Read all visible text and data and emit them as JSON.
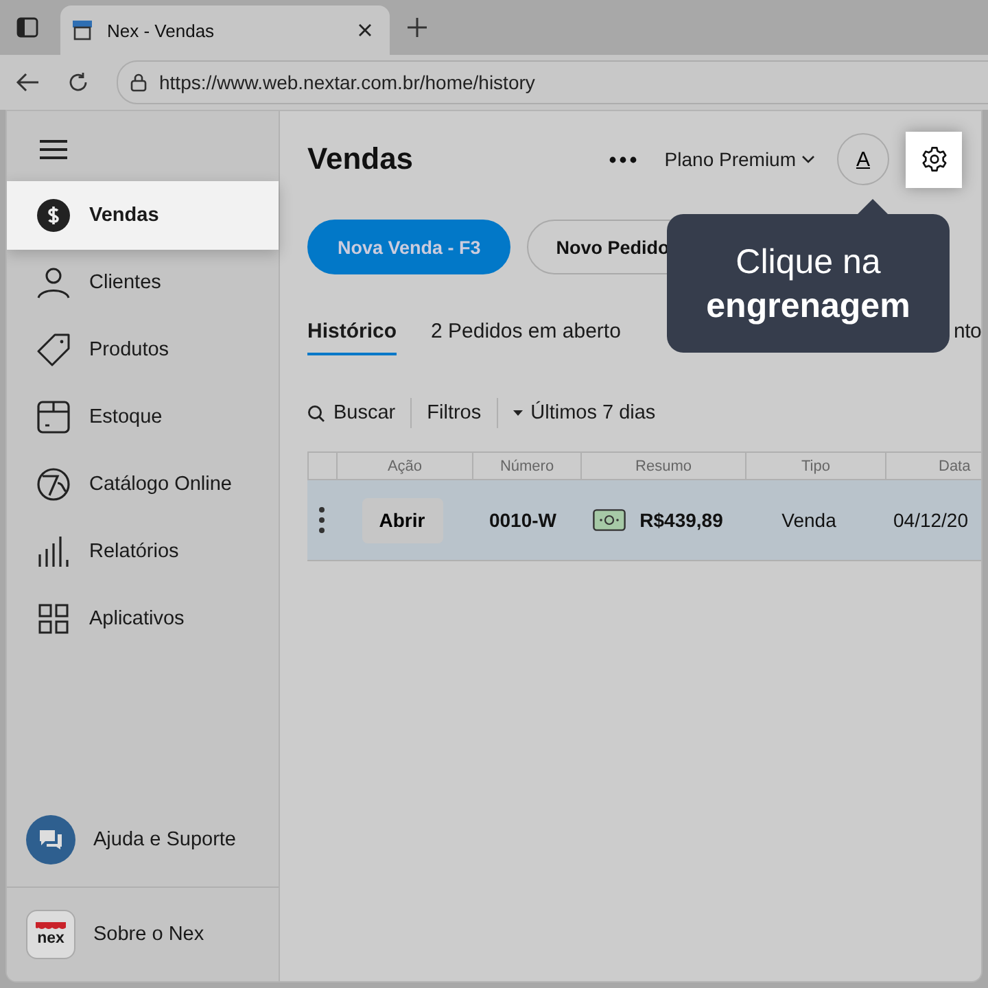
{
  "browser": {
    "tab_title": "Nex - Vendas",
    "url": "https://www.web.nextar.com.br/home/history"
  },
  "sidebar": {
    "items": [
      {
        "label": "Vendas",
        "kind": "dollar",
        "selected": true
      },
      {
        "label": "Clientes",
        "kind": "person",
        "selected": false
      },
      {
        "label": "Produtos",
        "kind": "tag",
        "selected": false
      },
      {
        "label": "Estoque",
        "kind": "box",
        "selected": false
      },
      {
        "label": "Catálogo Online",
        "kind": "catalog",
        "selected": false
      },
      {
        "label": "Relatórios",
        "kind": "bars",
        "selected": false
      },
      {
        "label": "Aplicativos",
        "kind": "grid",
        "selected": false
      }
    ],
    "help": "Ajuda e Suporte",
    "about": "Sobre o Nex",
    "logo_text": "nex"
  },
  "header": {
    "title": "Vendas",
    "plan": "Plano Premium",
    "avatar": "A"
  },
  "actions": [
    "Nova Venda - F3",
    "Novo Pedido"
  ],
  "tabs": [
    {
      "label": "Histórico",
      "selected": true
    },
    {
      "label": "2 Pedidos em aberto",
      "selected": false
    },
    {
      "label": "nto",
      "selected": false
    }
  ],
  "toolbar": {
    "search": "Buscar",
    "filters": "Filtros",
    "period": "Últimos 7 dias"
  },
  "table": {
    "columns": [
      "Ação",
      "Número",
      "Resumo",
      "Tipo",
      "Data"
    ],
    "rows": [
      {
        "action": "Abrir",
        "number": "0010-W",
        "summary": "R$439,89",
        "type": "Venda",
        "date": "04/12/20",
        "selected": true
      }
    ]
  },
  "tooltip": {
    "line1": "Clique na",
    "line2": "engrenagem"
  }
}
